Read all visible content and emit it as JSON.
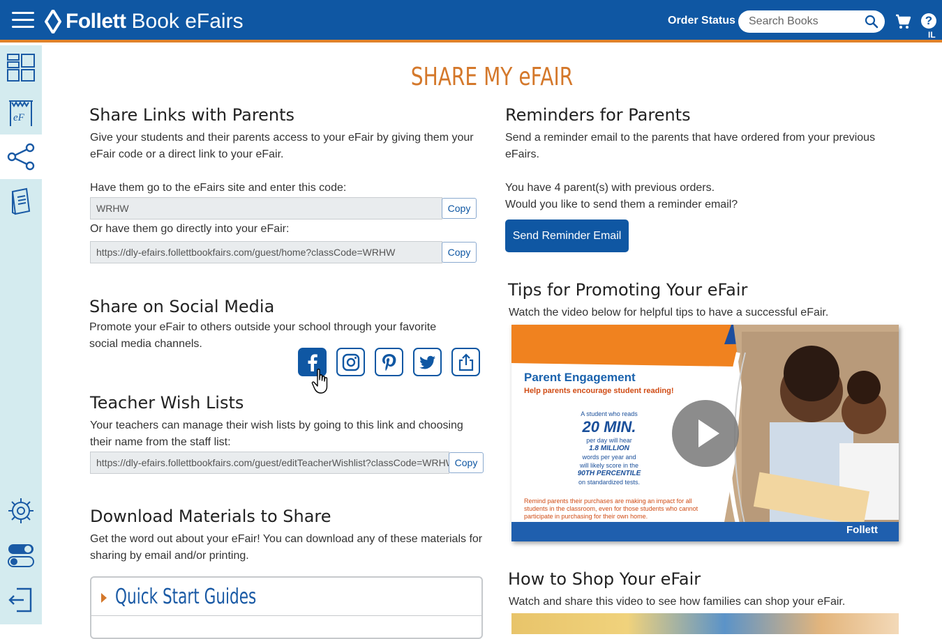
{
  "header": {
    "brand_bold": "Follett",
    "brand_rest": "Book eFairs",
    "order_status": "Order Status",
    "search_placeholder": "Search Books",
    "help": "?",
    "state": "IL"
  },
  "sidebar": {
    "items": [
      {
        "icon": "dashboard-icon"
      },
      {
        "icon": "efair-banner-icon"
      },
      {
        "icon": "share-icon",
        "active": true
      },
      {
        "icon": "book-icon"
      },
      {
        "icon": "settings-gear-icon"
      },
      {
        "icon": "toggle-switch-icon"
      },
      {
        "icon": "logout-icon"
      }
    ]
  },
  "page": {
    "title": "SHARE MY eFAIR"
  },
  "share_links": {
    "heading": "Share Links with Parents",
    "description": "Give your students and their parents access to your eFair by giving them your eFair code or a direct link to your eFair.",
    "code_label": "Have them go to the eFairs site and enter this code:",
    "code_value": "WRHW",
    "link_label": "Or have them go directly into your eFair:",
    "link_value": "https://dly-efairs.follettbookfairs.com/guest/home?classCode=WRHW",
    "copy": "Copy"
  },
  "social": {
    "heading": "Share on Social Media",
    "description": "Promote your eFair to others outside your school through your favorite social media channels.",
    "channels": [
      "facebook-icon",
      "instagram-icon",
      "pinterest-icon",
      "twitter-icon",
      "share-upload-icon"
    ]
  },
  "wishlists": {
    "heading": "Teacher Wish Lists",
    "description": "Your teachers can manage their wish lists by going to this link and choosing their name from the staff list:",
    "link_value": "https://dly-efairs.follettbookfairs.com/guest/editTeacherWishlist?classCode=WRHW",
    "copy": "Copy"
  },
  "downloads": {
    "heading": "Download Materials to Share",
    "description": "Get the word out about your eFair! You can download any of these materials for sharing by email and/or printing.",
    "accordion_label": "Quick Start Guides"
  },
  "reminders": {
    "heading": "Reminders for Parents",
    "description": "Send a reminder email to the parents that have ordered from your previous eFairs.",
    "count_text": "You have 4 parent(s) with previous orders.",
    "question": "Would you like to send them a reminder email?",
    "button": "Send Reminder Email"
  },
  "tips": {
    "heading": "Tips for Promoting Your eFair",
    "description": "Watch the video below for helpful tips to have a successful eFair.",
    "video": {
      "title": "Parent Engagement",
      "subtitle": "Help parents encourage student reading!",
      "stat_line1": "A student who reads",
      "stat_big": "20 MIN.",
      "stat_line2": "per day will hear",
      "stat_mid1": "1.8 MILLION",
      "stat_line3": "words per year and",
      "stat_line4": "will likely score in the",
      "stat_mid2": "90TH PERCENTILE",
      "stat_line5": "on standardized tests.",
      "note": "Remind parents their purchases are making an impact for all students in the classroom, even for those students who cannot participate in purchasing for their own home.",
      "brand": "Follett"
    }
  },
  "howto": {
    "heading": "How to Shop Your eFair",
    "description": "Watch and share this video to see how families can shop your eFair."
  },
  "colors": {
    "primary": "#0f57a3",
    "accent_orange": "#e0822a",
    "sidebar_bg": "#d4ebef"
  }
}
